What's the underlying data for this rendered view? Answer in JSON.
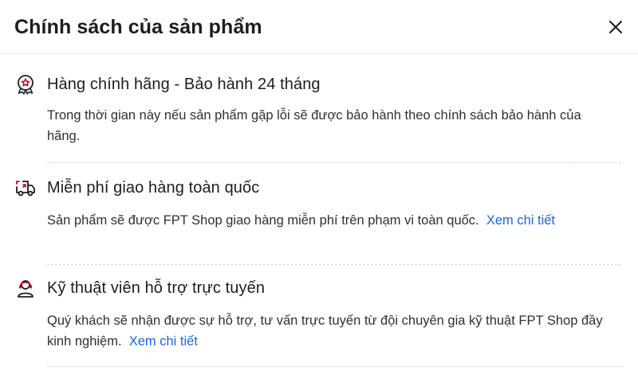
{
  "dialog": {
    "title": "Chính sách của sản phẩm",
    "close_icon": "close-icon"
  },
  "policies": [
    {
      "icon": "genuine-badge-icon",
      "heading": "Hàng chính hãng - Bảo hành 24 tháng",
      "description": "Trong thời gian này nếu sản phẩm gặp lỗi sẽ được bảo hành theo chính sách bảo hành của hãng.",
      "link": ""
    },
    {
      "icon": "delivery-truck-icon",
      "heading": "Miễn phí giao hàng toàn quốc",
      "description": "Sản phẩm sẽ được FPT Shop giao hàng miễn phí trên phạm vi toàn quốc.",
      "link": "Xem chi tiết"
    },
    {
      "icon": "support-agent-icon",
      "heading": "Kỹ thuật viên hỗ trợ trực tuyến",
      "description": "Quý khách sẽ nhận được sự hỗ trợ, tư vấn trực tuyến từ đội chuyên gia kỹ thuật FPT Shop đầy kinh nghiệm.",
      "link": "Xem chi tiết"
    }
  ],
  "colors": {
    "text": "#1b1d22",
    "link": "#1b67e0",
    "accent_red": "#d0021b",
    "divider": "#d6d9de"
  }
}
